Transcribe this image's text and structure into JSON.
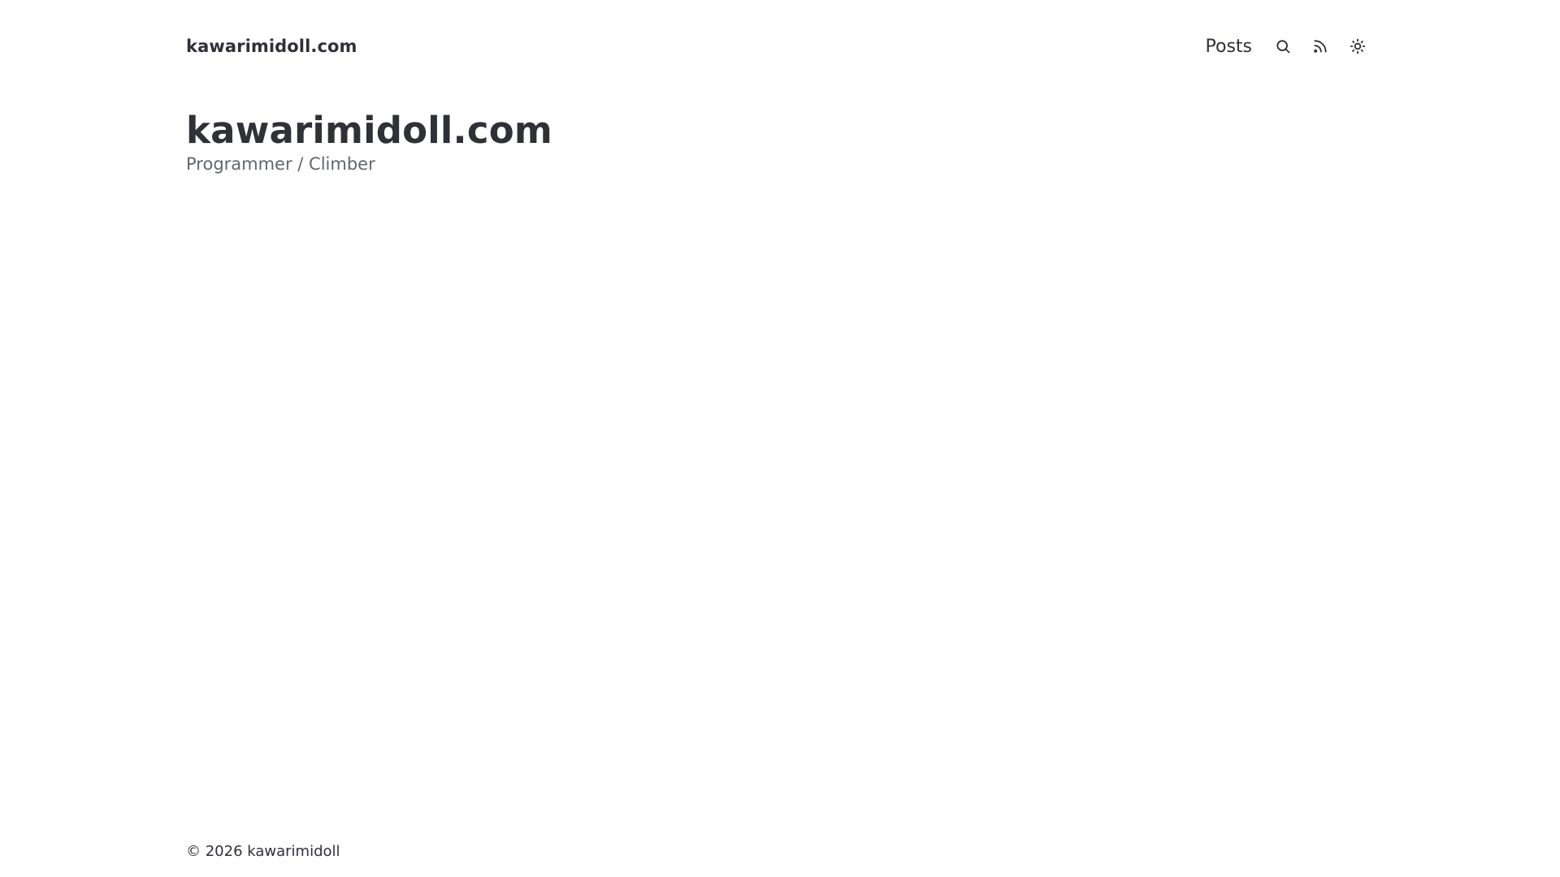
{
  "header": {
    "brand": "kawarimidoll.com",
    "nav": {
      "posts_label": "Posts",
      "search_icon": "search-icon",
      "rss_icon": "rss-icon",
      "theme_icon": "sun-icon"
    }
  },
  "intro": {
    "title": "kawarimidoll.com",
    "subtitle": "Programmer / Climber"
  },
  "footer": {
    "copyright": "© 2026 kawarimidoll"
  },
  "colors": {
    "text": "#2f3136",
    "muted": "#62666e",
    "background": "#ffffff"
  }
}
